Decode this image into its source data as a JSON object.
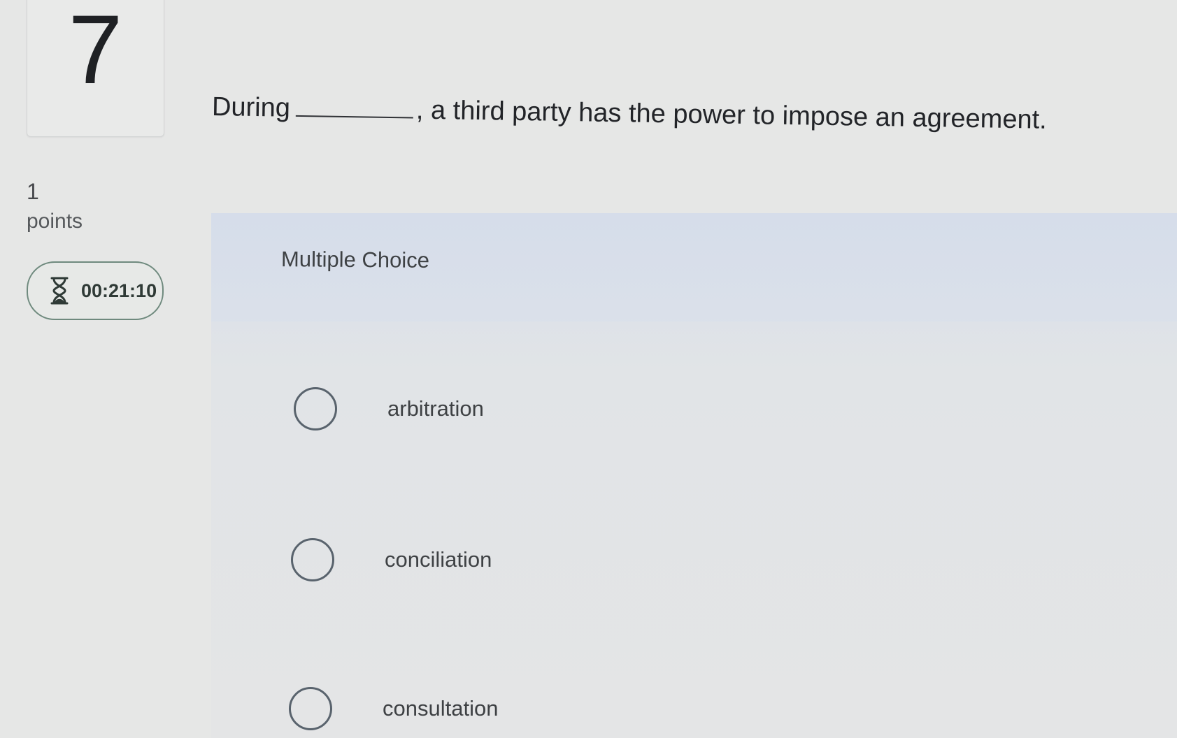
{
  "question": {
    "number": "7",
    "prompt_before": "During",
    "prompt_after": ", a third party has the power to impose an agreement."
  },
  "points": {
    "value": "1",
    "label": "points"
  },
  "timer": {
    "icon": "hourglass-icon",
    "value": "00:21:10"
  },
  "answer_section": {
    "type_label": "Multiple Choice",
    "options": [
      {
        "label": "arbitration",
        "selected": false
      },
      {
        "label": "conciliation",
        "selected": false
      },
      {
        "label": "consultation",
        "selected": false
      }
    ]
  },
  "colors": {
    "background": "#e6e7e6",
    "panel": "#dce1e8",
    "timer_border": "#6f8a7e",
    "radio_border": "#59636d"
  }
}
